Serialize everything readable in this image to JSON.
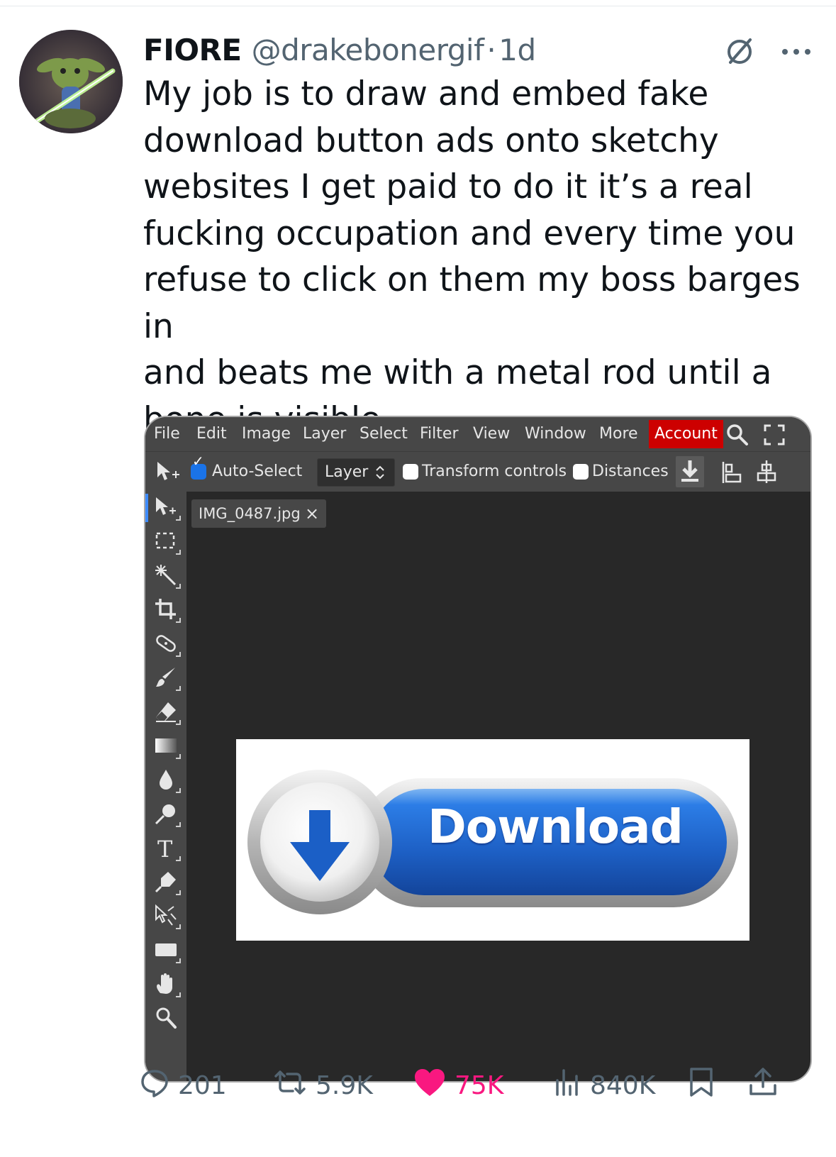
{
  "tweet": {
    "display_name": "FIORE",
    "handle": "@drakebonergif",
    "separator": "·",
    "time": "1d",
    "text": "My job is to draw and embed fake\ndownload button ads onto sketchy\nwebsites I get paid to do it it’s a real\nfucking occupation and every time you\nrefuse to click on them my boss barges in\nand beats me with a metal rod until a\nbone is visible"
  },
  "editor": {
    "menu": [
      "File",
      "Edit",
      "Image",
      "Layer",
      "Select",
      "Filter",
      "View",
      "Window",
      "More"
    ],
    "account_label": "Account",
    "options": {
      "auto_select_label": "Auto-Select",
      "auto_select_checked": true,
      "layer_select_value": "Layer",
      "transform_controls_label": "Transform controls",
      "transform_controls_checked": false,
      "distances_label": "Distances",
      "distances_checked": false
    },
    "tab_label": "IMG_0487.jpg",
    "tab_close": "×",
    "canvas_button_text": "Download",
    "colors": {
      "accent_red": "#cd0000",
      "panel": "#474747",
      "workspace": "#282828",
      "button_blue": "#1d5fc4"
    }
  },
  "actions": {
    "replies": "201",
    "reposts": "5.9K",
    "likes": "75K",
    "views": "840K"
  }
}
